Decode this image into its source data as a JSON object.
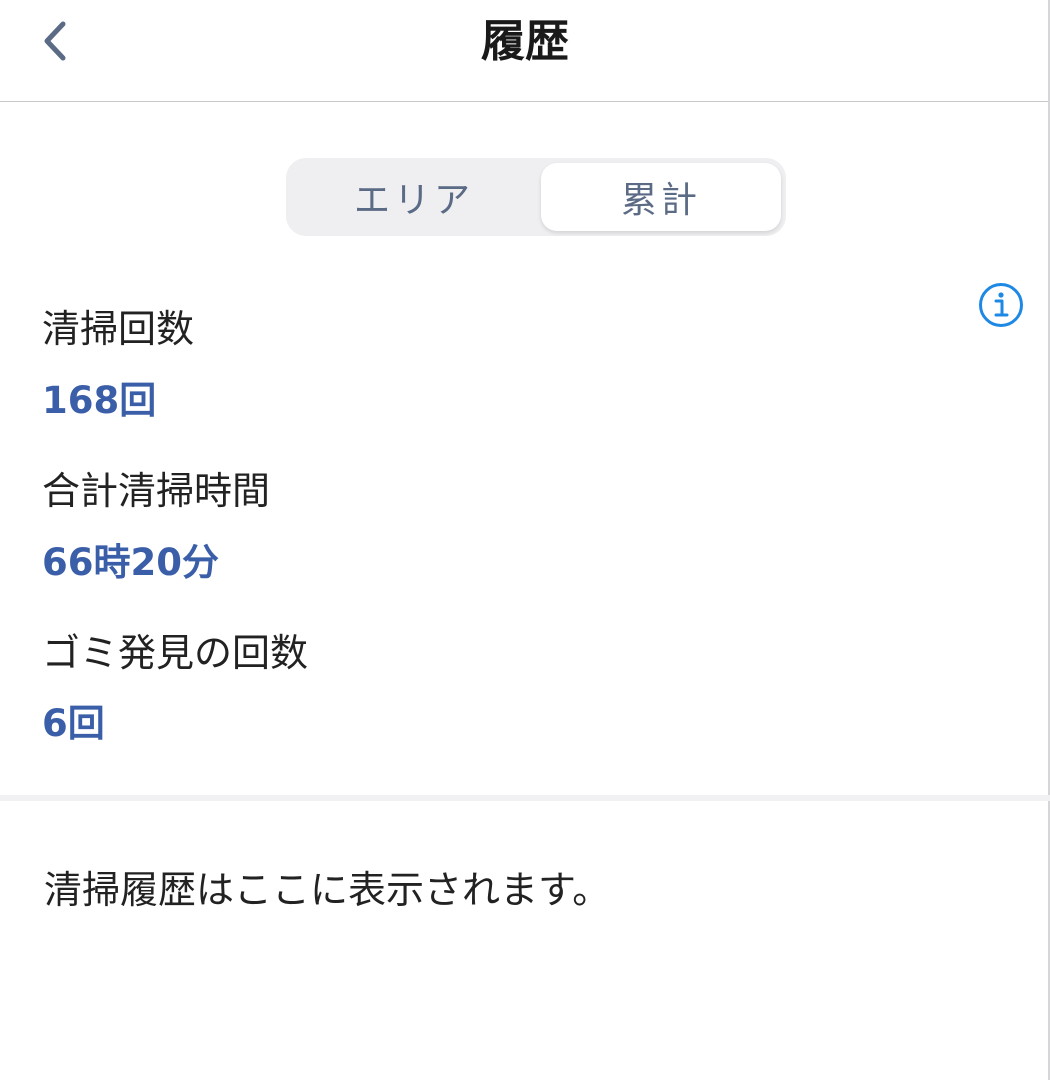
{
  "nav": {
    "title": "履歴",
    "back_icon": "chevron-left-icon"
  },
  "segments": [
    {
      "label": "エリア",
      "selected": false
    },
    {
      "label": "累計",
      "selected": true
    }
  ],
  "info_icon": "info-icon",
  "stats": [
    {
      "label": "清掃回数",
      "value": "168回"
    },
    {
      "label": "合計清掃時間",
      "value": "66時20分"
    },
    {
      "label": "ゴミ発見の回数",
      "value": "6回"
    }
  ],
  "history": {
    "message": "清掃履歴はここに表示されます。"
  },
  "colors": {
    "accent": "#3a5fa8",
    "info": "#1e88e5",
    "segment_bg": "#efeff2",
    "segment_text": "#5b6b85"
  }
}
